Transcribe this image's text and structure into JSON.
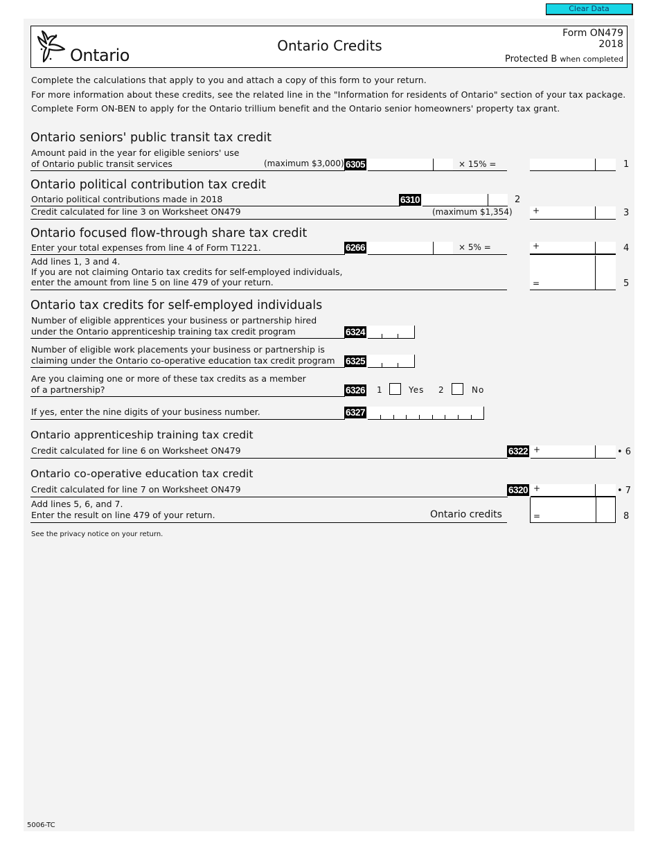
{
  "toolbar": {
    "clear_label": "Clear Data"
  },
  "header": {
    "logo_text": "Ontario",
    "title": "Ontario Credits",
    "form_number": "Form ON479",
    "year": "2018",
    "protected": "Protected B",
    "protected_note": "when completed"
  },
  "intro": [
    "Complete the calculations that apply to you and attach a copy of this form to your return.",
    "For more information about these credits, see the related line in the \"Information for residents of Ontario\" section of your tax package.",
    "Complete Form ON-BEN to apply for the Ontario trillium benefit and the Ontario senior homeowners' property tax grant."
  ],
  "sections": {
    "transit": {
      "heading": "Ontario seniors' public transit tax credit",
      "line1_text_a": "Amount paid in the year for eligible seniors' use",
      "line1_text_b": "of Ontario public transit services",
      "line1_max": "(maximum $3,000)",
      "line1_code": "6305",
      "line1_rate": "×  15%  =",
      "line1_num": "1"
    },
    "political": {
      "heading": "Ontario political contribution tax credit",
      "line2_text": "Ontario political contributions made in 2018",
      "line2_code": "6310",
      "line2_num": "2",
      "line3_text": "Credit calculated for line 3 on Worksheet ON479",
      "line3_max": "(maximum $1,354)",
      "line3_sign": "+",
      "line3_num": "3"
    },
    "flowthrough": {
      "heading": "Ontario focused flow-through share tax credit",
      "line4_text": "Enter your total expenses from line 4 of Form T1221.",
      "line4_code": "6266",
      "line4_rate": "×   5%   =",
      "line4_sign": "+",
      "line4_num": "4",
      "line5_text_a": "Add lines 1, 3 and 4.",
      "line5_text_b": "If you are not claiming Ontario tax credits for self-employed individuals,",
      "line5_text_c": "enter the amount from line 5 on line 479 of your return.",
      "line5_sign": "=",
      "line5_num": "5"
    },
    "selfemployed": {
      "heading": "Ontario tax credits for self-employed individuals",
      "apprentices_text_a": "Number of eligible apprentices your business or partnership hired",
      "apprentices_text_b": "under the Ontario apprenticeship training tax credit program",
      "apprentices_code": "6324",
      "placements_text_a": "Number of eligible work placements your business or partnership is",
      "placements_text_b": "claiming under the Ontario co-operative education tax credit program",
      "placements_code": "6325",
      "partnership_text_a": "Are you claiming one or more of these tax credits as a member",
      "partnership_text_b": "of a partnership?",
      "partnership_code": "6326",
      "option_yes_num": "1",
      "option_yes": "Yes",
      "option_no_num": "2",
      "option_no": "No",
      "bn_text": "If yes, enter the nine digits of your business number.",
      "bn_code": "6327"
    },
    "apprenticeship": {
      "heading": "Ontario apprenticeship training tax credit",
      "line6_text": "Credit calculated for line 6 on Worksheet ON479",
      "line6_code": "6322",
      "line6_sign": "+",
      "line6_num": "• 6"
    },
    "coop": {
      "heading": "Ontario co-operative education tax credit",
      "line7_text": "Credit calculated for line 7 on Worksheet ON479",
      "line7_code": "6320",
      "line7_sign": "+",
      "line7_num": "• 7",
      "line8_text_a": "Add lines 5, 6, and 7.",
      "line8_text_b": "Enter the result on line 479 of your return.",
      "line8_label": "Ontario credits",
      "line8_sign": "=",
      "line8_num": "8"
    }
  },
  "footer": {
    "privacy": "See the privacy notice on your return.",
    "form_code": "5006-TC"
  }
}
